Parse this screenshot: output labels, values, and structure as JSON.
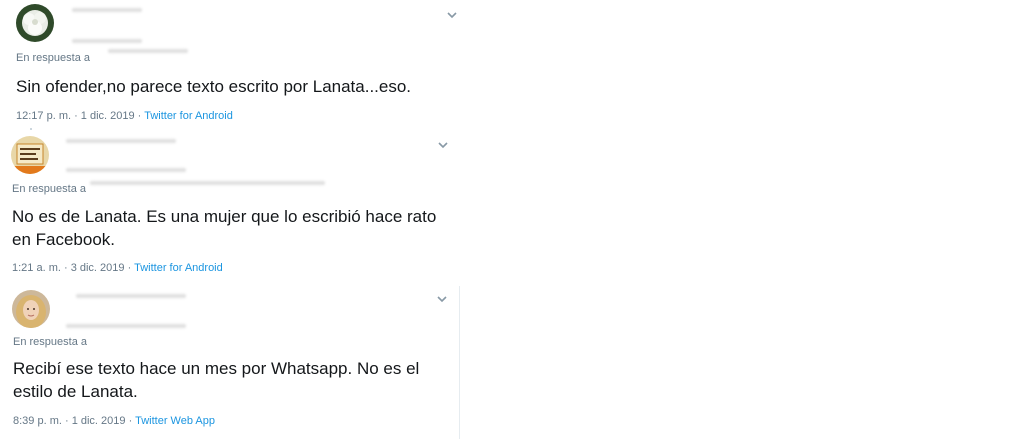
{
  "tweets": [
    {
      "reply_prefix": "En respuesta a",
      "text": "Sin ofender,no parece texto escrito por Lanata...eso.",
      "time": "12:17 p. m. · 1 dic. 2019 · ",
      "client": "Twitter for Android",
      "avatar_icon": "flower-avatar-icon"
    },
    {
      "reply_prefix": "En respuesta a",
      "text": "No es de Lanata. Es una mujer que lo escribió hace rato\nen Facebook.",
      "time": "1:21 a. m. · 3 dic. 2019 · ",
      "client": "Twitter for Android",
      "avatar_icon": "sign-avatar-icon"
    },
    {
      "reply_prefix": "En respuesta a",
      "text": "Recibí ese texto hace un mes por Whatsapp. No es el\nestilo de Lanata.",
      "time": "8:39 p. m. · 1 dic. 2019 · ",
      "client": "Twitter Web App",
      "avatar_icon": "person-avatar-icon"
    }
  ],
  "colors": {
    "link": "#1b95e0",
    "secondary": "#657786",
    "text": "#14171a"
  }
}
